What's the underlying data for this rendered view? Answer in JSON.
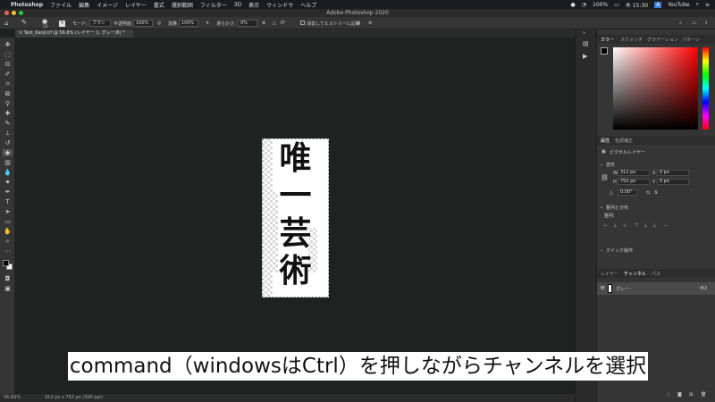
{
  "menubar": {
    "apple": "",
    "items": [
      "Photoshop",
      "ファイル",
      "編集",
      "イメージ",
      "レイヤー",
      "書式",
      "選択範囲",
      "フィルター",
      "3D",
      "表示",
      "ウィンドウ",
      "ヘルプ"
    ],
    "battery": "100%",
    "clock": "木 15:30",
    "youtube": "YouTube"
  },
  "window": {
    "title": "Adobe Photoshop 2020"
  },
  "options": {
    "brush_size": "13",
    "mode_label": "モード:",
    "mode_value": "ブラシ",
    "opacity_label": "不透明度:",
    "opacity_value": "100%",
    "flow_label": "流量:",
    "flow_value": "100%",
    "smoothing_label": "滑らかさ:",
    "smoothing_value": "0%",
    "angle_value": "0°",
    "history_label": "消去してヒストリーに記録"
  },
  "document": {
    "tab_title": "Text_Kanji.tif @ 56.8% (レイヤー 1, グレー/8) *",
    "kanji": [
      "唯",
      "一",
      "芸",
      "術"
    ]
  },
  "status": {
    "zoom": "56.83%",
    "info": "312 px x 752 px (300 ppi)"
  },
  "color_panel": {
    "tabs": [
      "カラー",
      "スウォッチ",
      "グラデーション",
      "パターン"
    ]
  },
  "properties_panel": {
    "tabs": [
      "属性",
      "色調補正"
    ],
    "layer_type": "ピクセルレイヤー",
    "transform_label": "変形",
    "w_label": "W",
    "w_value": "312 px",
    "h_label": "H",
    "h_value": "752 px",
    "x_label": "X",
    "x_value": "0 px",
    "y_label": "Y",
    "y_value": "0 px",
    "angle_value": "0.00°",
    "align_label": "整列と分布",
    "align_sub": "整列:",
    "quick_actions": "クイック操作"
  },
  "layers_panel": {
    "tabs": [
      "レイヤー",
      "チャンネル",
      "パス"
    ],
    "channel_name": "グレー",
    "channel_shortcut": "⌘2"
  },
  "caption": "command（windowsはCtrl）を押しながらチャンネルを選択",
  "colors": {
    "canvas_bg": "#1e2220",
    "panel_bg": "#353535",
    "menubar_bg": "#1b1c1d"
  }
}
